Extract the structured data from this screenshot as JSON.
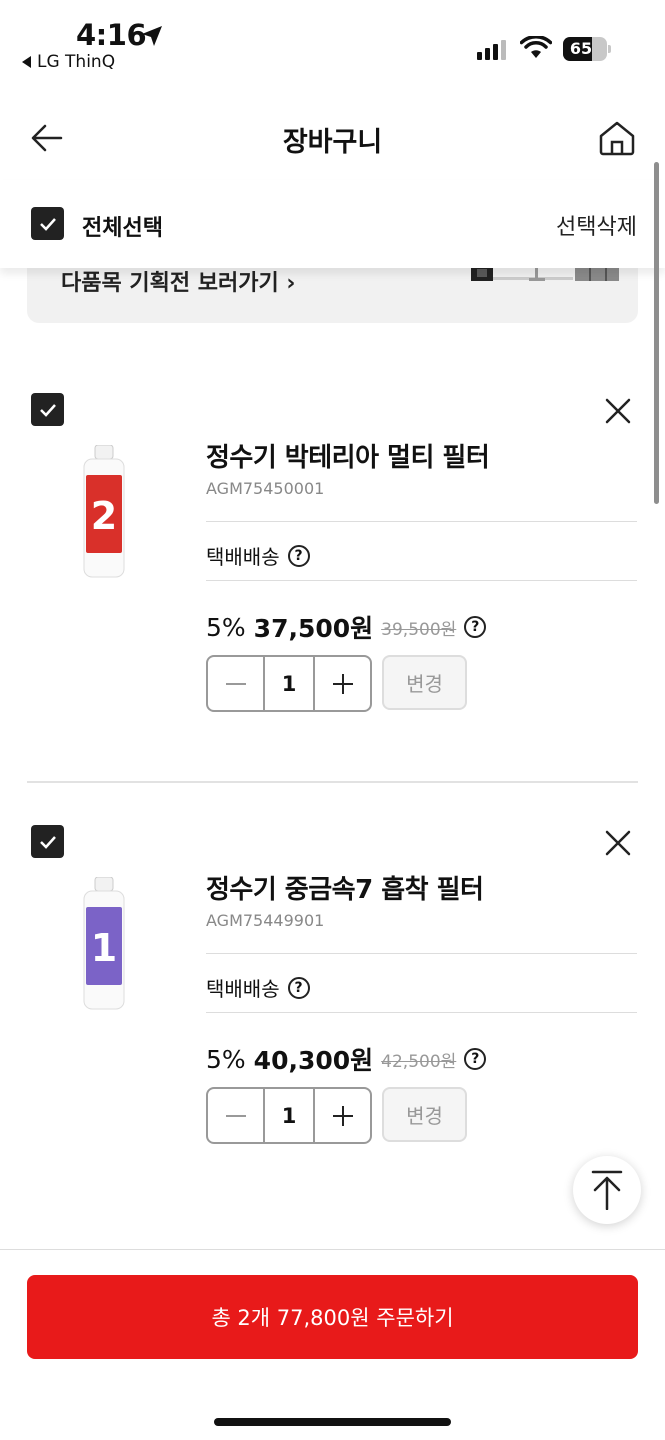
{
  "status_bar": {
    "time": "4:16",
    "back_app": "LG ThinQ",
    "battery": "65",
    "battery_level": 0.65
  },
  "header": {
    "title": "장바구니"
  },
  "select_bar": {
    "select_all_label": "전체선택",
    "delete_selected_label": "선택삭제"
  },
  "promo": {
    "text": "다품목 기획전 보러가기 ›"
  },
  "items": [
    {
      "name": "정수기 박테리아 멀티 필터",
      "code": "AGM75450001",
      "shipping": "택배배송",
      "discount": "5%",
      "sale_price": "37,500원",
      "original_price": "39,500원",
      "quantity": "1",
      "change_label": "변경",
      "filter_number": "2",
      "filter_color": "#d9302a"
    },
    {
      "name": "정수기 중금속7 흡착 필터",
      "code": "AGM75449901",
      "shipping": "택배배송",
      "discount": "5%",
      "sale_price": "40,300원",
      "original_price": "42,500원",
      "quantity": "1",
      "change_label": "변경",
      "filter_number": "1",
      "filter_color": "#7b63c7"
    }
  ],
  "order": {
    "button_label": "총 2개 77,800원 주문하기",
    "accent_color": "#e81a1a"
  }
}
